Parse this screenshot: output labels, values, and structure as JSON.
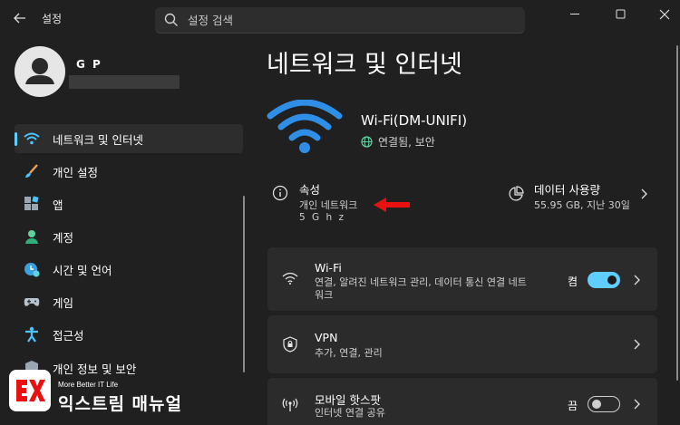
{
  "app": {
    "title": "설정"
  },
  "search": {
    "placeholder": "설정 검색"
  },
  "profile": {
    "name": "G P"
  },
  "sidebar": {
    "items": [
      {
        "label": "네트워크 및 인터넷",
        "icon": "network-icon",
        "active": true
      },
      {
        "label": "개인 설정",
        "icon": "brush-icon"
      },
      {
        "label": "앱",
        "icon": "apps-icon"
      },
      {
        "label": "계정",
        "icon": "account-icon"
      },
      {
        "label": "시간 및 언어",
        "icon": "time-language-icon"
      },
      {
        "label": "게임",
        "icon": "gamepad-icon"
      },
      {
        "label": "접근성",
        "icon": "accessibility-icon"
      },
      {
        "label": "개인 정보 및 보안",
        "icon": "shield-icon"
      }
    ]
  },
  "main": {
    "title": "네트워크 및 인터넷",
    "network": {
      "name": "Wi-Fi(DM-UNIFI)",
      "status": "연결됨, 보안"
    },
    "properties": {
      "title": "속성",
      "line1": "개인 네트워크",
      "line2": "5 G h z"
    },
    "data_usage": {
      "title": "데이터 사용량",
      "detail": "55.95 GB, 지난 30일"
    },
    "cards": {
      "wifi": {
        "title": "Wi-Fi",
        "desc_line1": "연결, 알려진 네트워크 관리, 데이터 통신 연결 네트",
        "desc_line2": "워크",
        "toggle_label": "켬",
        "toggle_on": true
      },
      "vpn": {
        "title": "VPN",
        "desc": "추가, 연결, 관리"
      },
      "hotspot": {
        "title": "모바일 핫스팟",
        "desc": "인터넷 연결 공유",
        "toggle_label": "끔",
        "toggle_on": false
      }
    }
  },
  "watermark": {
    "tagline": "More Better IT Life",
    "name": "익스트림 매뉴얼"
  },
  "colors": {
    "accent": "#60cdff",
    "background": "#202020",
    "card": "#2b2b2b",
    "annotation_arrow": "#e81010"
  }
}
